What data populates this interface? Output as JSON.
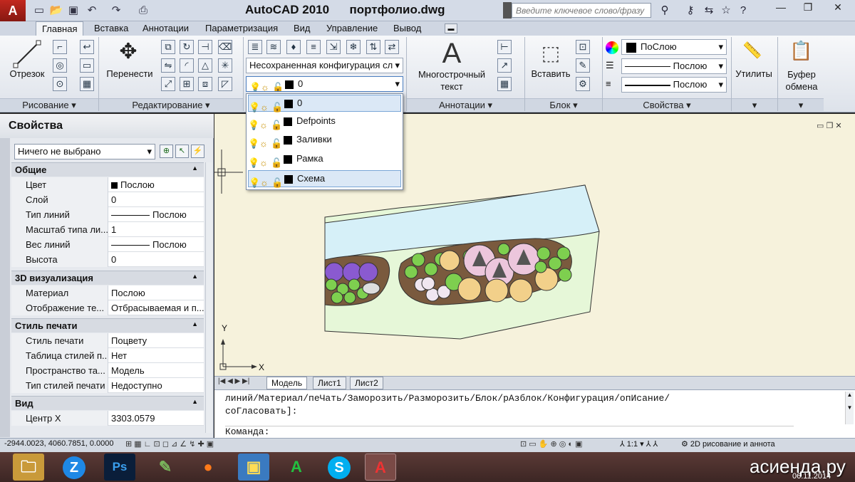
{
  "titlebar": {
    "app": "AutoCAD 2010",
    "file": "портфолио.dwg",
    "search_placeholder": "Введите ключевое слово/фразу"
  },
  "tabs": [
    "Главная",
    "Вставка",
    "Аннотации",
    "Параметризация",
    "Вид",
    "Управление",
    "Вывод"
  ],
  "ribbon": {
    "draw": {
      "line_label": "Отрезок",
      "title": "Рисование"
    },
    "modify": {
      "move_label": "Перенести",
      "title": "Редактирование"
    },
    "layers": {
      "config": "Несохраненная конфигурация сл",
      "current_layer": "0"
    },
    "annot": {
      "mtext_line1": "Многострочный",
      "mtext_line2": "текст",
      "title": "Аннотации"
    },
    "block": {
      "insert_label": "Вставить",
      "title": "Блок"
    },
    "props": {
      "color": "ПоСлою",
      "linetype": "Послою",
      "lineweight": "Послою",
      "title": "Свойства"
    },
    "utils": {
      "label": "Утилиты"
    },
    "clipboard": {
      "line1": "Буфер",
      "line2": "обмена"
    }
  },
  "layer_dropdown": [
    {
      "name": "0",
      "highlighted": true
    },
    {
      "name": "Defpoints",
      "highlighted": false
    },
    {
      "name": "Заливки",
      "highlighted": false
    },
    {
      "name": "Рамка",
      "highlighted": false
    },
    {
      "name": "Схема",
      "highlighted": true
    }
  ],
  "properties": {
    "title": "Свойства",
    "selection": "Ничего не выбрано",
    "sections": {
      "general": "Общие",
      "viz3d": "3D визуализация",
      "print": "Стиль печати",
      "view": "Вид"
    },
    "rows": {
      "color": {
        "k": "Цвет",
        "v": "Послою"
      },
      "layer": {
        "k": "Слой",
        "v": "0"
      },
      "linetype": {
        "k": "Тип линий",
        "v": "Послою"
      },
      "ltscale": {
        "k": "Масштаб типа ли...",
        "v": "1"
      },
      "lineweight": {
        "k": "Вес линий",
        "v": "Послою"
      },
      "height": {
        "k": "Высота",
        "v": "0"
      },
      "material": {
        "k": "Материал",
        "v": "Послою"
      },
      "shadow": {
        "k": "Отображение те...",
        "v": "Отбрасываемая и п..."
      },
      "plotstyle": {
        "k": "Стиль печати",
        "v": "Поцвету"
      },
      "plottable": {
        "k": "Таблица стилей п...",
        "v": "Нет"
      },
      "plotspace": {
        "k": "Пространство та...",
        "v": "Модель"
      },
      "plottype": {
        "k": "Тип стилей печати",
        "v": "Недоступно"
      },
      "centerx": {
        "k": "Центр X",
        "v": "3303.0579"
      }
    }
  },
  "model_tabs": [
    "Модель",
    "Лист1",
    "Лист2"
  ],
  "command": {
    "line1": "линий/Материал/пеЧать/Заморозить/Разморозить/Блок/рАзблок/Конфигурация/опИсание/",
    "line2": "соГласовать]:",
    "prompt": "Команда:"
  },
  "status": {
    "coords": "-2944.0023, 4060.7851, 0.0000",
    "scale": "1:1",
    "workspace": "2D рисование и аннота"
  },
  "ucs": {
    "x": "X",
    "y": "Y"
  },
  "taskbar": {
    "date": "06.11.2014",
    "watermark": "асиенда.ру"
  },
  "colors": {
    "accent": "#c2281f",
    "water": "#d6f0f8",
    "lawn": "#e6f7d8",
    "bed": "#7a5a3e",
    "highlight": "#dbe8f6"
  }
}
